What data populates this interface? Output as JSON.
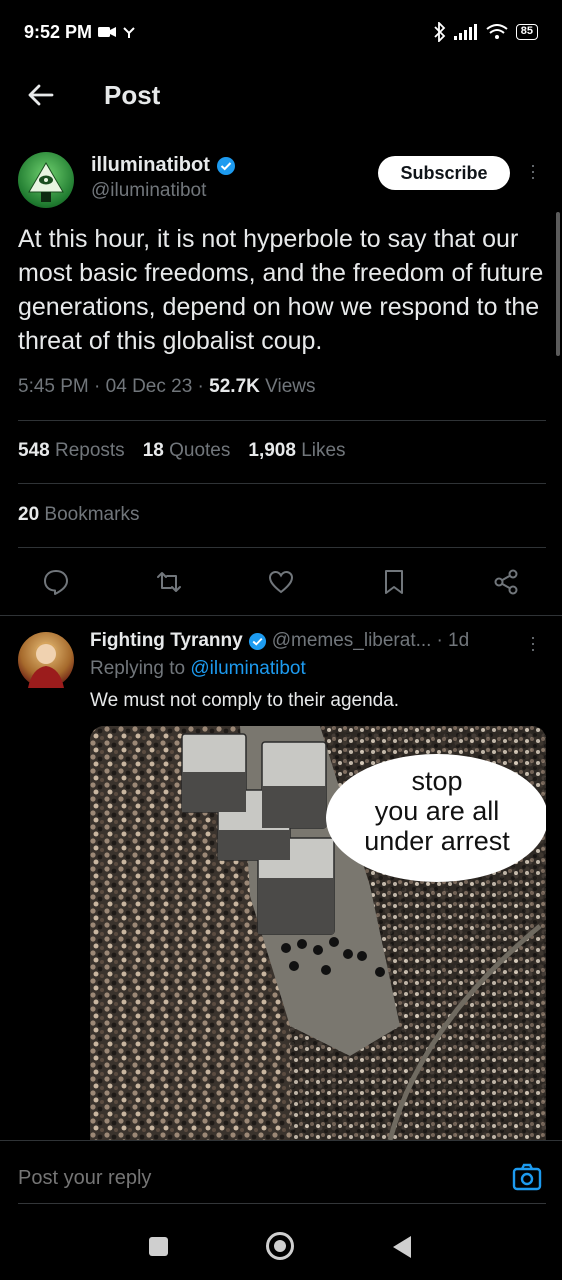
{
  "status_bar": {
    "time": "9:52 PM",
    "battery": "85"
  },
  "header": {
    "title": "Post"
  },
  "post": {
    "author_name": "illuminatibot",
    "author_handle": "@iluminatibot",
    "subscribe_label": "Subscribe",
    "text": "At this hour, it is not hyperbole to say that our most basic freedoms,  and the freedom of future generations, depend on how we respond to the threat of this globalist coup.",
    "time": "5:45 PM",
    "date": "04 Dec 23",
    "views_count": "52.7K",
    "views_label": "Views",
    "reposts_count": "548",
    "reposts_label": "Reposts",
    "quotes_count": "18",
    "quotes_label": "Quotes",
    "likes_count": "1,908",
    "likes_label": "Likes",
    "bookmarks_count": "20",
    "bookmarks_label": "Bookmarks"
  },
  "reply": {
    "author_name": "Fighting Tyranny",
    "author_handle": "@memes_liberat...",
    "age": "· 1d",
    "replying_prefix": "Replying to ",
    "replying_to": "@iluminatibot",
    "text": "We must not comply to their agenda.",
    "image_caption": "stop you are all under arrest"
  },
  "composer": {
    "placeholder": "Post your reply"
  },
  "colors": {
    "accent": "#1d9bf0",
    "background": "#000000",
    "muted": "#71767b"
  }
}
